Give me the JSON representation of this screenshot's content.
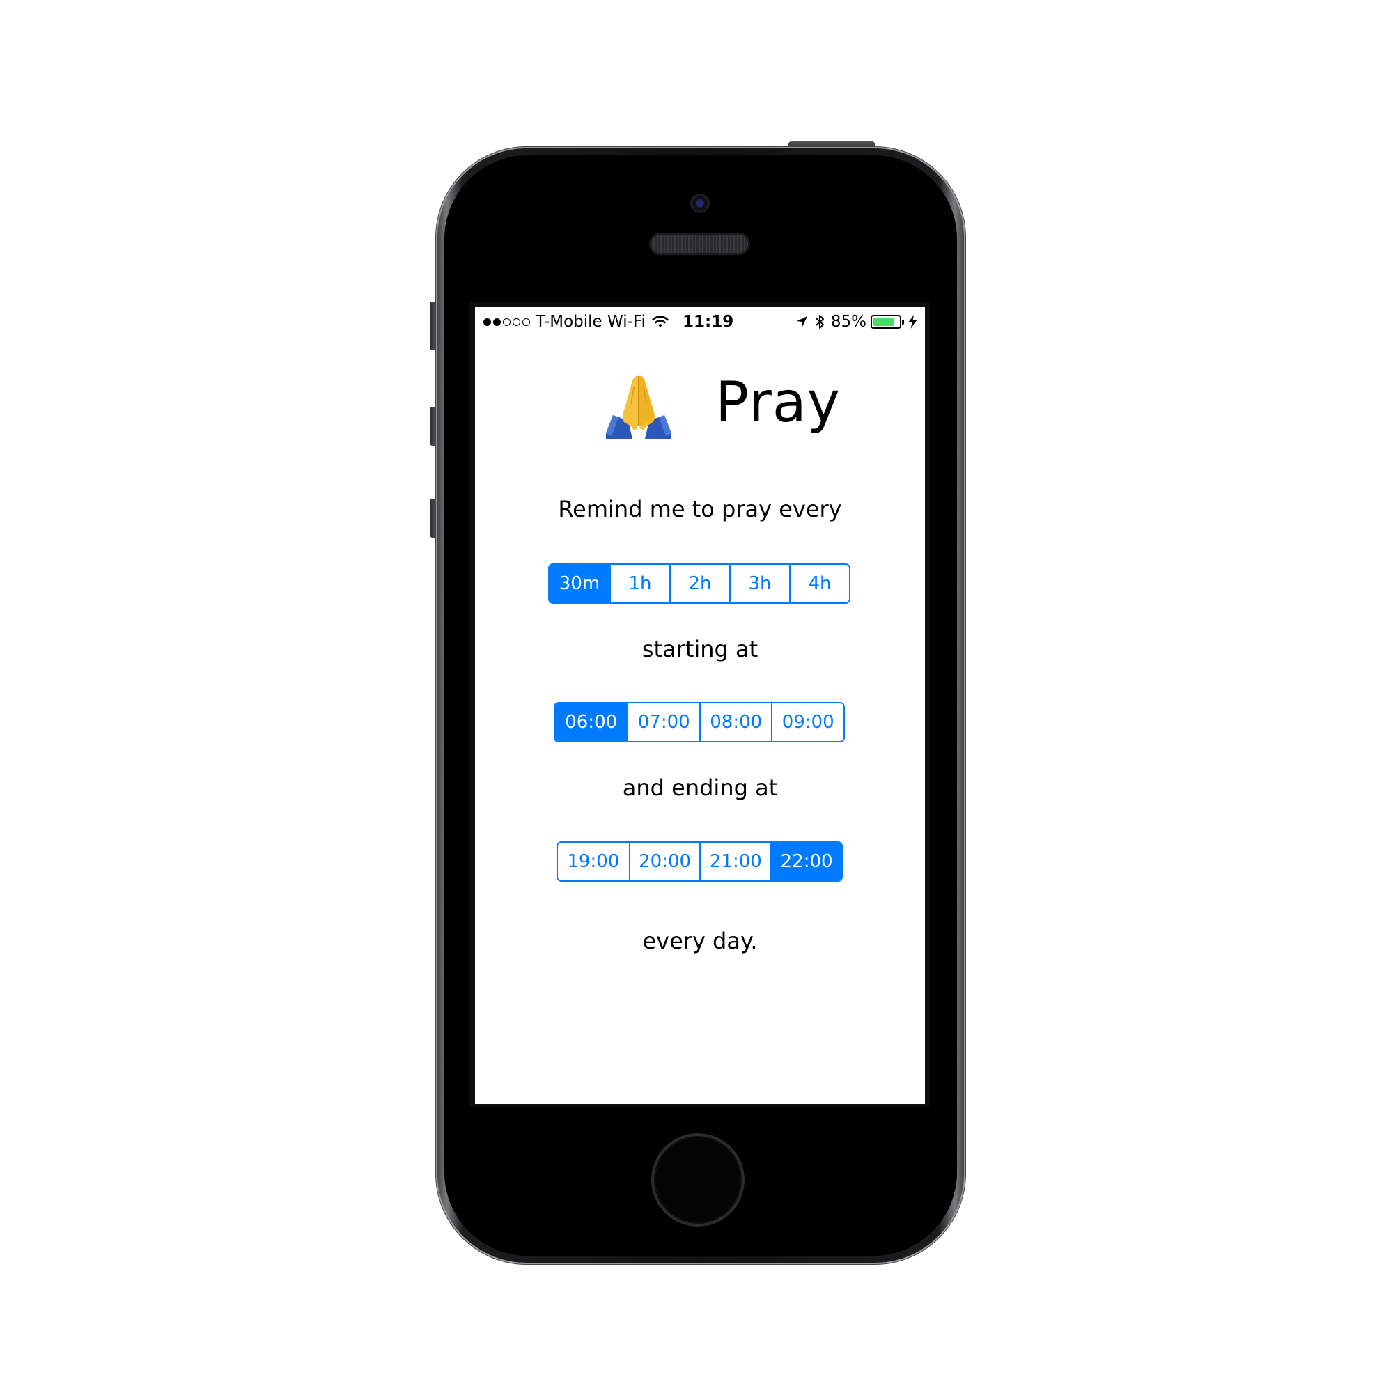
{
  "status_bar": {
    "signal_icon": "cellular-signal-icon",
    "signal_bars_filled": 2,
    "signal_bars_total": 5,
    "carrier": "T-Mobile Wi-Fi",
    "wifi_icon": "wifi-icon",
    "time": "11:19",
    "location_icon": "location-arrow-icon",
    "bluetooth_icon": "bluetooth-icon",
    "battery_percent_label": "85%",
    "battery_level": 0.85,
    "battery_color": "#4cd964",
    "charging_icon": "charging-bolt-icon"
  },
  "header": {
    "icon": "praying-hands-icon",
    "title": "Pray"
  },
  "interval": {
    "prompt": "Remind me to pray every",
    "options": [
      "30m",
      "1h",
      "2h",
      "3h",
      "4h"
    ],
    "selected": "30m"
  },
  "start": {
    "prompt": "starting at",
    "options": [
      "06:00",
      "07:00",
      "08:00",
      "09:00"
    ],
    "selected": "06:00"
  },
  "end": {
    "prompt": "and ending at",
    "options": [
      "19:00",
      "20:00",
      "21:00",
      "22:00"
    ],
    "selected": "22:00"
  },
  "footer": {
    "text": "every day."
  },
  "colors": {
    "accent": "#007aff",
    "text": "#000000",
    "background": "#ffffff"
  }
}
